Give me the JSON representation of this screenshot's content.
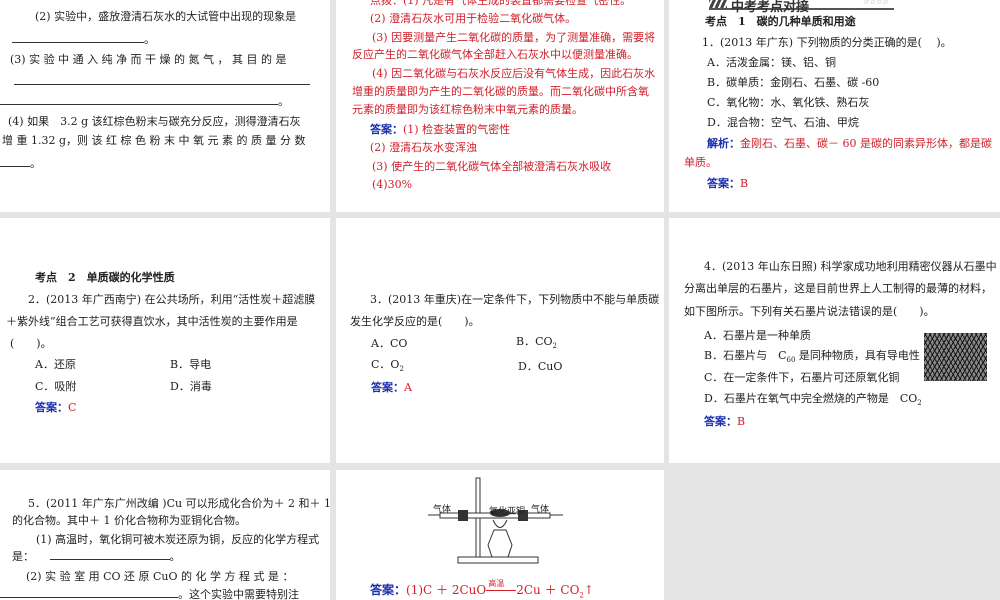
{
  "slides": [
    {
      "lines": [
        "(2) 实验中，盛放澄清石灰水的大试管中出现的现象是",
        "。",
        "(3) 实 验 中 通 入 纯 净 而 干 燥 的 氮 气 ， 其 目 的 是",
        "。",
        "(4) 如果　3.2 g 该红棕色粉末与碳充分反应，测得澄清石灰",
        "增 重 1.32 g，则 该 红 棕 色 粉 末 中 氧 元 素 的 质 量 分 数",
        "。"
      ]
    },
    {
      "lines": [
        "点拨：(1) 凡是有气体生成的装置都需要检查气密性。",
        "(2) 澄清石灰水可用于检验二氧化碳气体。",
        "(3) 因要测量产生二氧化碳的质量，为了测量准确，需要将",
        "反应产生的二氧化碳气体全部赶入石灰水中以便测量准确。",
        "(4) 因二氧化碳与石灰水反应后没有气体生成，因此石灰水",
        "增重的质量即为产生的二氧化碳的质量。而二氧化碳中所含氧",
        "元素的质量即为该红棕色粉末中氧元素的质量。"
      ],
      "answer_label": "答案：",
      "answers": [
        "(1) 检查装置的气密性",
        "(2) 澄清石灰水变浑浊",
        "(3) 使产生的二氧化碳气体全部被澄清石灰水吸收",
        "(4)30%"
      ]
    },
    {
      "banner": "中考考点对接",
      "stars": "☆☆☆☆",
      "topic": "考点　1　碳的几种单质和用途",
      "question": "1．(2013 年广东) 下列物质的分类正确的是(　 )。",
      "options": [
        "A．活泼金属：镁、铝、铜",
        "B．碳单质：金刚石、石墨、碳 -60",
        "C．氧化物：水、氧化铁、熟石灰",
        "D．混合物：空气、石油、甲烷"
      ],
      "analysis_label": "解析：",
      "analysis": [
        "金刚石、石墨、碳－ 60 是碳的同素异形体，都是碳",
        "单质。"
      ],
      "answer_label": "答案：",
      "answer": "B"
    },
    {
      "topic": "考点　2　单质碳的化学性质",
      "question": [
        "2．(2013 年广西南宁) 在公共场所，利用“活性炭＋超滤膜",
        "＋紫外线”组合工艺可获得直饮水，其中活性炭的主要作用是",
        "(　　)。"
      ],
      "options": [
        "A．还原",
        "B．导电",
        "C．吸附",
        "D．消毒"
      ],
      "answer_label": "答案：",
      "answer": "C"
    },
    {
      "question": [
        "3．(2013 年重庆)在一定条件下，下列物质中不能与单质碳",
        "发生化学反应的是(　　)。"
      ],
      "options": [
        "A．CO",
        "B．CO",
        "C．O",
        "D．CuO"
      ],
      "sub2": "2",
      "answer_label": "答案：",
      "answer": "A"
    },
    {
      "question": [
        "4．(2013 年山东日照) 科学家成功地利用精密仪器从石墨中",
        "分离出单层的石墨片，这是目前世界上人工制得的最薄的材料，",
        "如下图所示。下列有关石墨片说法错误的是(　　)。"
      ],
      "options": [
        "A．石墨片是一种单质",
        "B．石墨片与　C",
        "是同种物质，具有导电性",
        "C．在一定条件下，石墨片可还原氧化铜",
        "D．石墨片在氧气中完全燃烧的产物是　CO"
      ],
      "c60_sub": "60",
      "sub2": "2",
      "answer_label": "答案：",
      "answer": "B"
    },
    {
      "lines": [
        "5．(2011 年广东广州改编 )Cu 可以形成化合价为＋ 2 和＋ 1",
        "的化合物。其中＋ 1 价化合物称为亚铜化合物。",
        "(1) 高温时，氧化铜可被木炭还原为铜，反应的化学方程式",
        "是：",
        "。",
        "(2) 实 验 室 用 CO 还 原 CuO 的 化 学 方 程 式 是 ：",
        "。这个实验中需要特别注"
      ]
    },
    {
      "diagram": {
        "gas_in": "气体",
        "gas_out": "气体",
        "sample": "氧化亚铜"
      },
      "answer_label": "答案：",
      "eq_left": "(1)C ＋ 2CuO",
      "eq_condition": "高温",
      "eq_right": "2Cu ＋ CO",
      "eq_sub": "2",
      "eq_arrow": "↑"
    }
  ]
}
